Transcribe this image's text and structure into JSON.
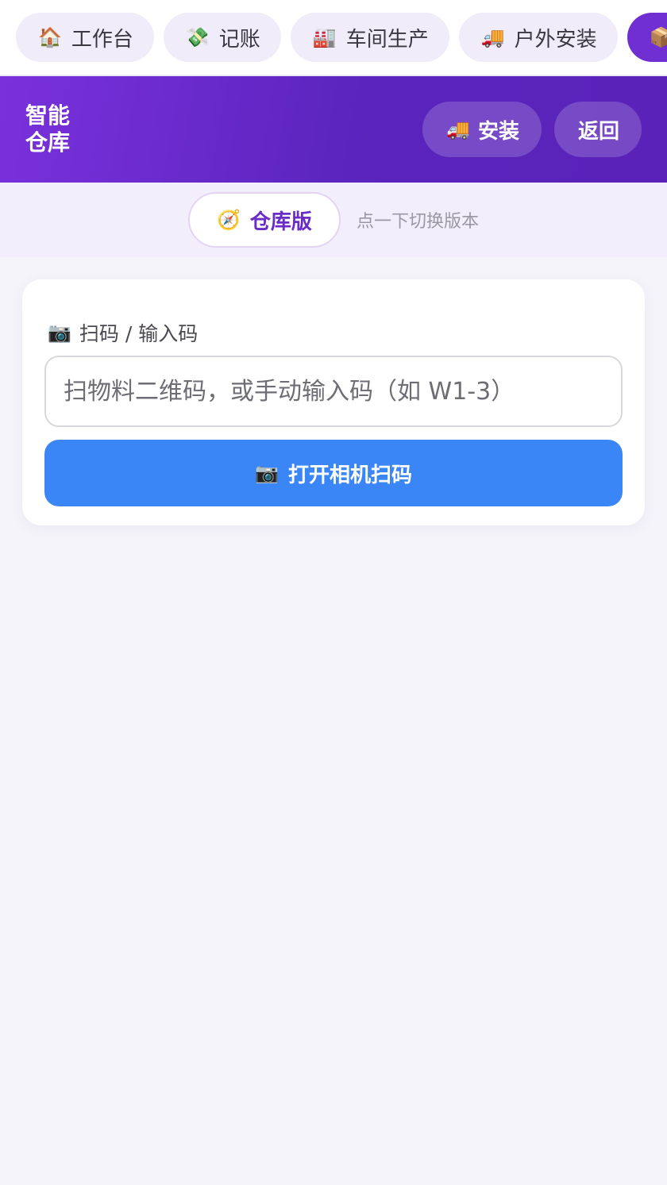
{
  "topnav": {
    "items": [
      {
        "icon": "🏠",
        "icon_name": "house-icon",
        "label": "工作台"
      },
      {
        "icon": "💸",
        "icon_name": "money-icon",
        "label": "记账"
      },
      {
        "icon": "🏭",
        "icon_name": "factory-icon",
        "label": "车间生产"
      },
      {
        "icon": "🚚",
        "icon_name": "truck-icon",
        "label": "户外安装"
      },
      {
        "icon": "📦",
        "icon_name": "package-icon",
        "label": ""
      }
    ]
  },
  "header": {
    "title": "智能仓库",
    "install_icon": "🚚",
    "install_label": "安装",
    "back_label": "返回"
  },
  "version": {
    "icon": "🧭",
    "label": "仓库版",
    "hint": "点一下切换版本"
  },
  "scan": {
    "label_icon": "📷",
    "label": "扫码 / 输入码",
    "placeholder": "扫物料二维码，或手动输入码（如 W1-3）",
    "value": "",
    "button_icon": "📷",
    "button_label": "打开相机扫码"
  },
  "colors": {
    "accent": "#6f2fd3",
    "header_start": "#7a31dc",
    "header_end": "#5a22b8",
    "primary_button": "#3b86f6",
    "background": "#f5f4fa"
  }
}
